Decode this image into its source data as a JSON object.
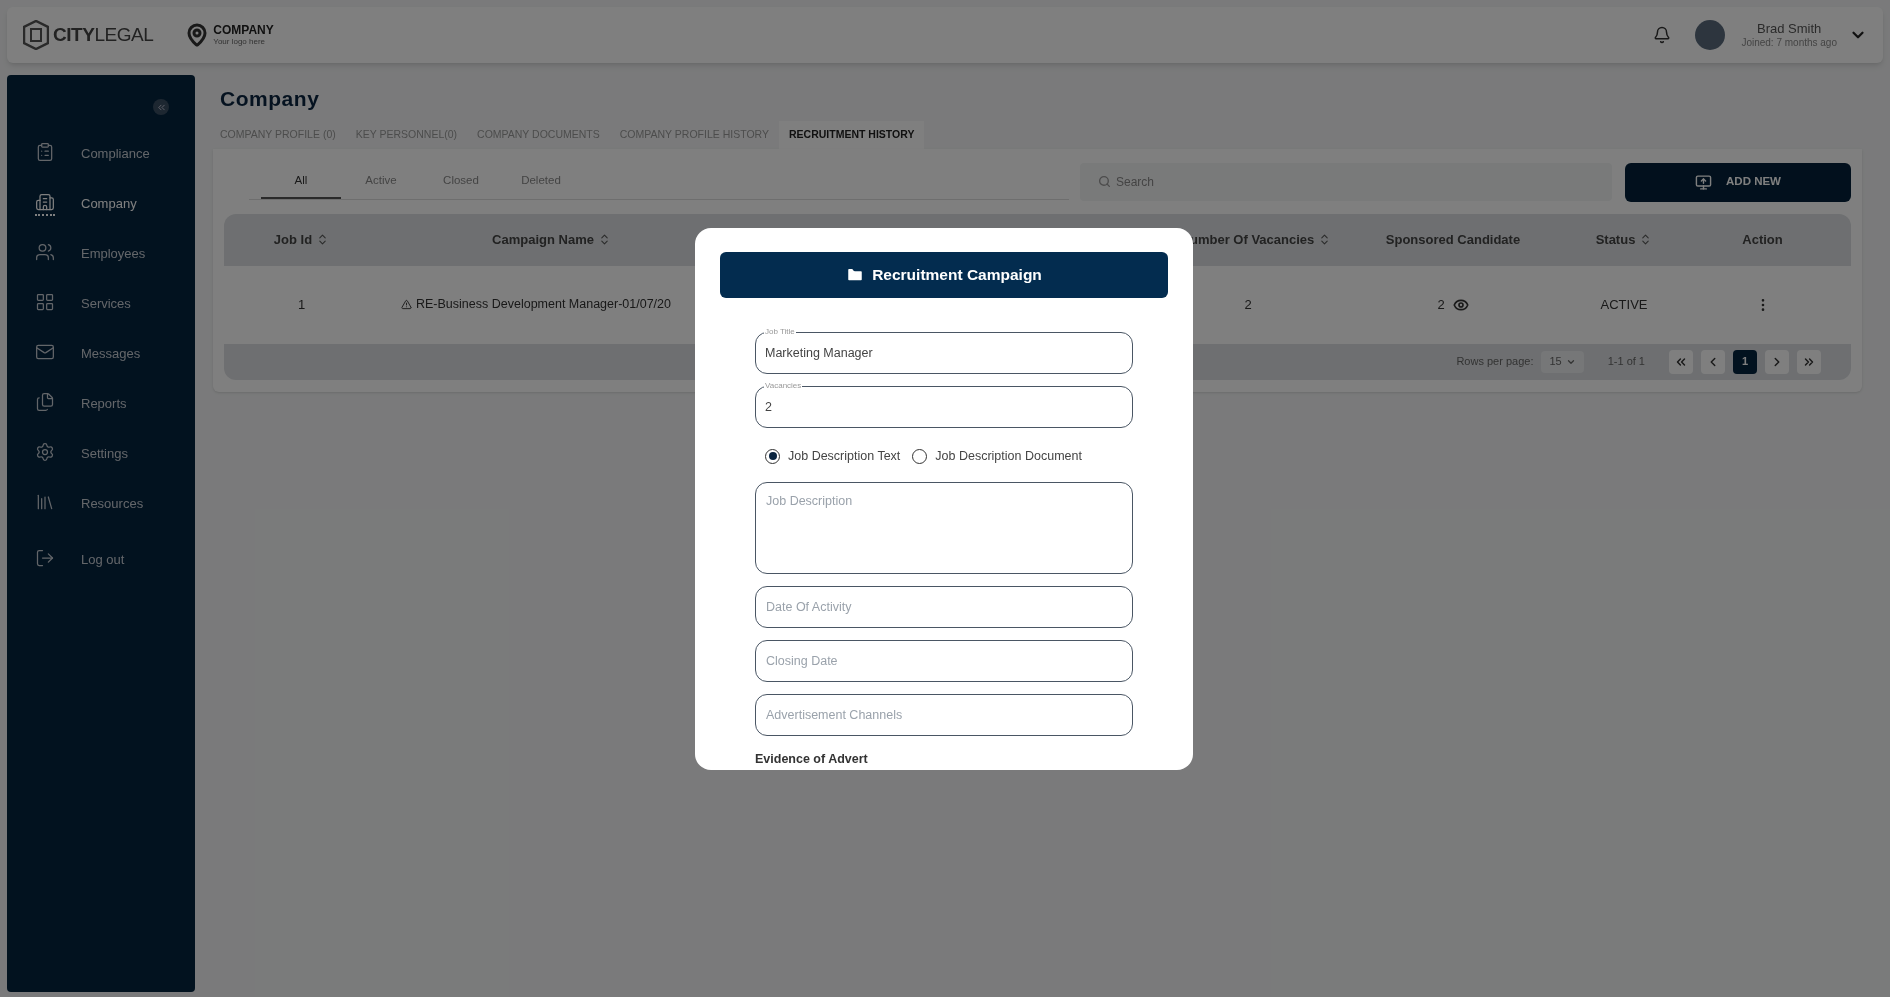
{
  "header": {
    "logo": "**CITY**LEGAL",
    "company_logo": {
      "name": "COMPANY",
      "tagline": "Your logo here"
    },
    "user": {
      "name": "Brad Smith",
      "joined": "Joined: 7 months ago"
    }
  },
  "sidebar": {
    "items": [
      {
        "label": "Compliance",
        "selected": false
      },
      {
        "label": "Company",
        "selected": true
      },
      {
        "label": "Employees",
        "selected": false
      },
      {
        "label": "Services",
        "selected": false
      },
      {
        "label": "Messages",
        "selected": false
      },
      {
        "label": "Reports",
        "selected": false
      },
      {
        "label": "Settings",
        "selected": false
      },
      {
        "label": "Resources",
        "selected": false
      },
      {
        "label": "Log out",
        "selected": false
      }
    ]
  },
  "page": {
    "title": "Company",
    "tabs": [
      {
        "label": "COMPANY PROFILE (0)",
        "selected": false
      },
      {
        "label": "KEY PERSONNEL(0)",
        "selected": false
      },
      {
        "label": "COMPANY DOCUMENTS",
        "selected": false
      },
      {
        "label": "COMPANY PROFILE HISTORY",
        "selected": false
      },
      {
        "label": "RECRUITMENT HISTORY",
        "selected": true
      }
    ],
    "filters": [
      {
        "label": "All",
        "selected": true
      },
      {
        "label": "Active",
        "selected": false
      },
      {
        "label": "Closed",
        "selected": false
      },
      {
        "label": "Deleted",
        "selected": false
      }
    ],
    "search": {
      "placeholder": "Search"
    },
    "add_button": "ADD NEW",
    "table": {
      "columns": [
        {
          "label": "Job Id",
          "sortable": true
        },
        {
          "label": "Campaign Name",
          "sortable": true
        },
        {
          "label": "umber Of Vacancies",
          "sortable": true
        },
        {
          "label": "Sponsored Candidate",
          "sortable": false
        },
        {
          "label": "Status",
          "sortable": true
        },
        {
          "label": "Action",
          "sortable": false
        }
      ],
      "rows": [
        {
          "job_id": "1",
          "campaign_name": "RE-Business Development Manager-01/07/20",
          "vacancies": "2",
          "sponsored": "2",
          "status": "ACTIVE"
        }
      ]
    },
    "pagination": {
      "rows_label": "Rows per page:",
      "rows_value": "15",
      "range": "1-1 of 1",
      "pages": [
        {
          "label": "1",
          "selected": true
        }
      ]
    }
  },
  "modal": {
    "title": "Recruitment Campaign",
    "fields": [
      {
        "kind": "outlined",
        "label": "Job Title",
        "value": "Marketing Manager"
      },
      {
        "kind": "outlined",
        "label": "Vacancies",
        "value": "2"
      },
      {
        "kind": "radio",
        "options": [
          {
            "label": "Job Description Text",
            "selected": true
          },
          {
            "label": "Job Description Document",
            "selected": false
          }
        ]
      },
      {
        "kind": "textarea",
        "placeholder": "Job Description"
      },
      {
        "kind": "input",
        "placeholder": "Date Of Activity"
      },
      {
        "kind": "input",
        "placeholder": "Closing Date"
      },
      {
        "kind": "input",
        "placeholder": "Advertisement Channels"
      }
    ],
    "section": "Evidence of Advert"
  }
}
